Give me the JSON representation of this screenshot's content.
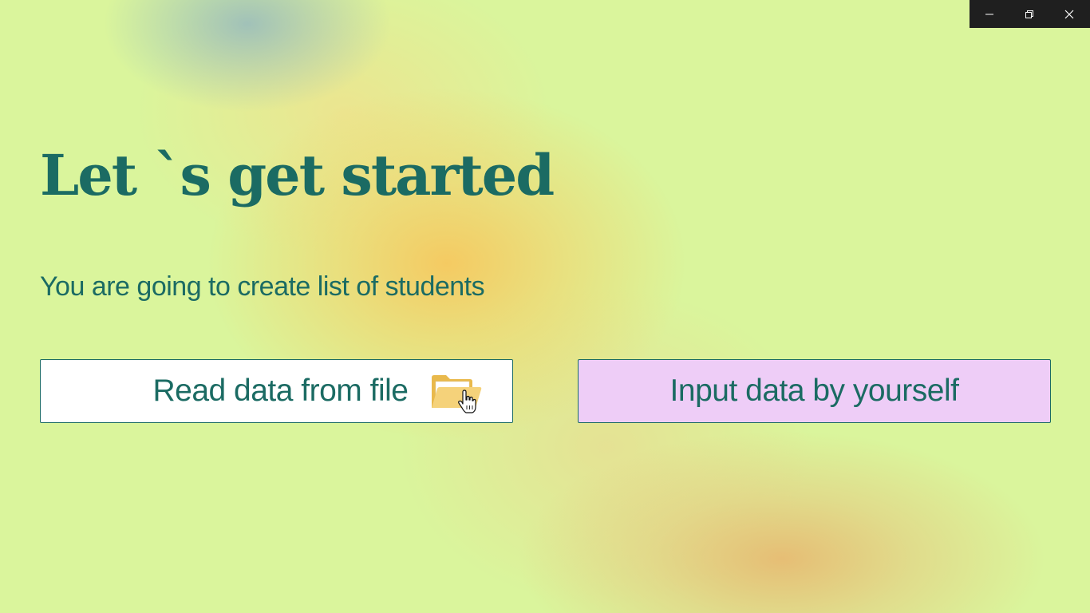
{
  "window_controls": {
    "minimize": "minimize",
    "restore": "restore",
    "close": "close"
  },
  "heading": "Let `s get started",
  "subheading": "You are going to create list of students",
  "buttons": {
    "read_file": "Read data from file",
    "input_manual": "Input data by yourself"
  },
  "icons": {
    "read_file": "folder-with-hand-cursor-icon"
  },
  "colors": {
    "background": "#daf59c",
    "accent_text": "#1b6b63",
    "read_button_bg": "#ffffff",
    "input_button_bg": "#eecdf7",
    "titlebar": "#1f1f1f"
  }
}
